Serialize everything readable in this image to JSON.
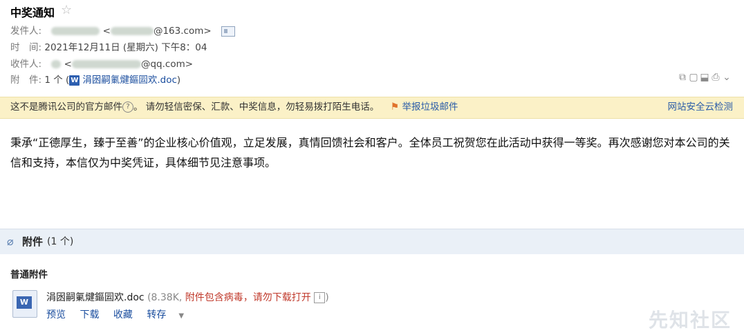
{
  "subject": "中奖通知",
  "sender": {
    "label": "发件人:",
    "email_suffix": "@163.com>"
  },
  "time": {
    "label": "时　间:",
    "value": "2021年12月11日 (星期六) 下午8：04"
  },
  "recipient": {
    "label": "收件人:",
    "email_suffix": "@qq.com>"
  },
  "attachment_row": {
    "label": "附　件:",
    "count": "1 个",
    "paren_open": "(",
    "filename": "涓囦嗣氭煡鏂囩欢.doc",
    "paren_close": ")"
  },
  "warning": {
    "text1": "这不是腾讯公司的官方邮件",
    "text2": "。 请勿轻信密保、汇款、中奖信息，勿轻易拨打陌生电话。",
    "report": "举报垃圾邮件",
    "safe_check": "网站安全云检测"
  },
  "body": "秉承“正德厚生，臻于至善”的企业核心价值观，立足发展，真情回馈社会和客户。全体员工祝贺您在此活动中获得一等奖。再次感谢您对本公司的关信和支持，本信仅为中奖凭证，具体细节见注意事项。",
  "attachments": {
    "title": "附件",
    "count": "(1 个)",
    "subheading": "普通附件",
    "file": {
      "name": "涓囦嗣氭煡鏂囩欢.doc",
      "size": "(8.38K,",
      "warning": "附件包含病毒，请勿下载打开",
      "close": ")"
    },
    "actions": [
      "预览",
      "下载",
      "收藏",
      "转存"
    ]
  },
  "watermark": "先知社区"
}
